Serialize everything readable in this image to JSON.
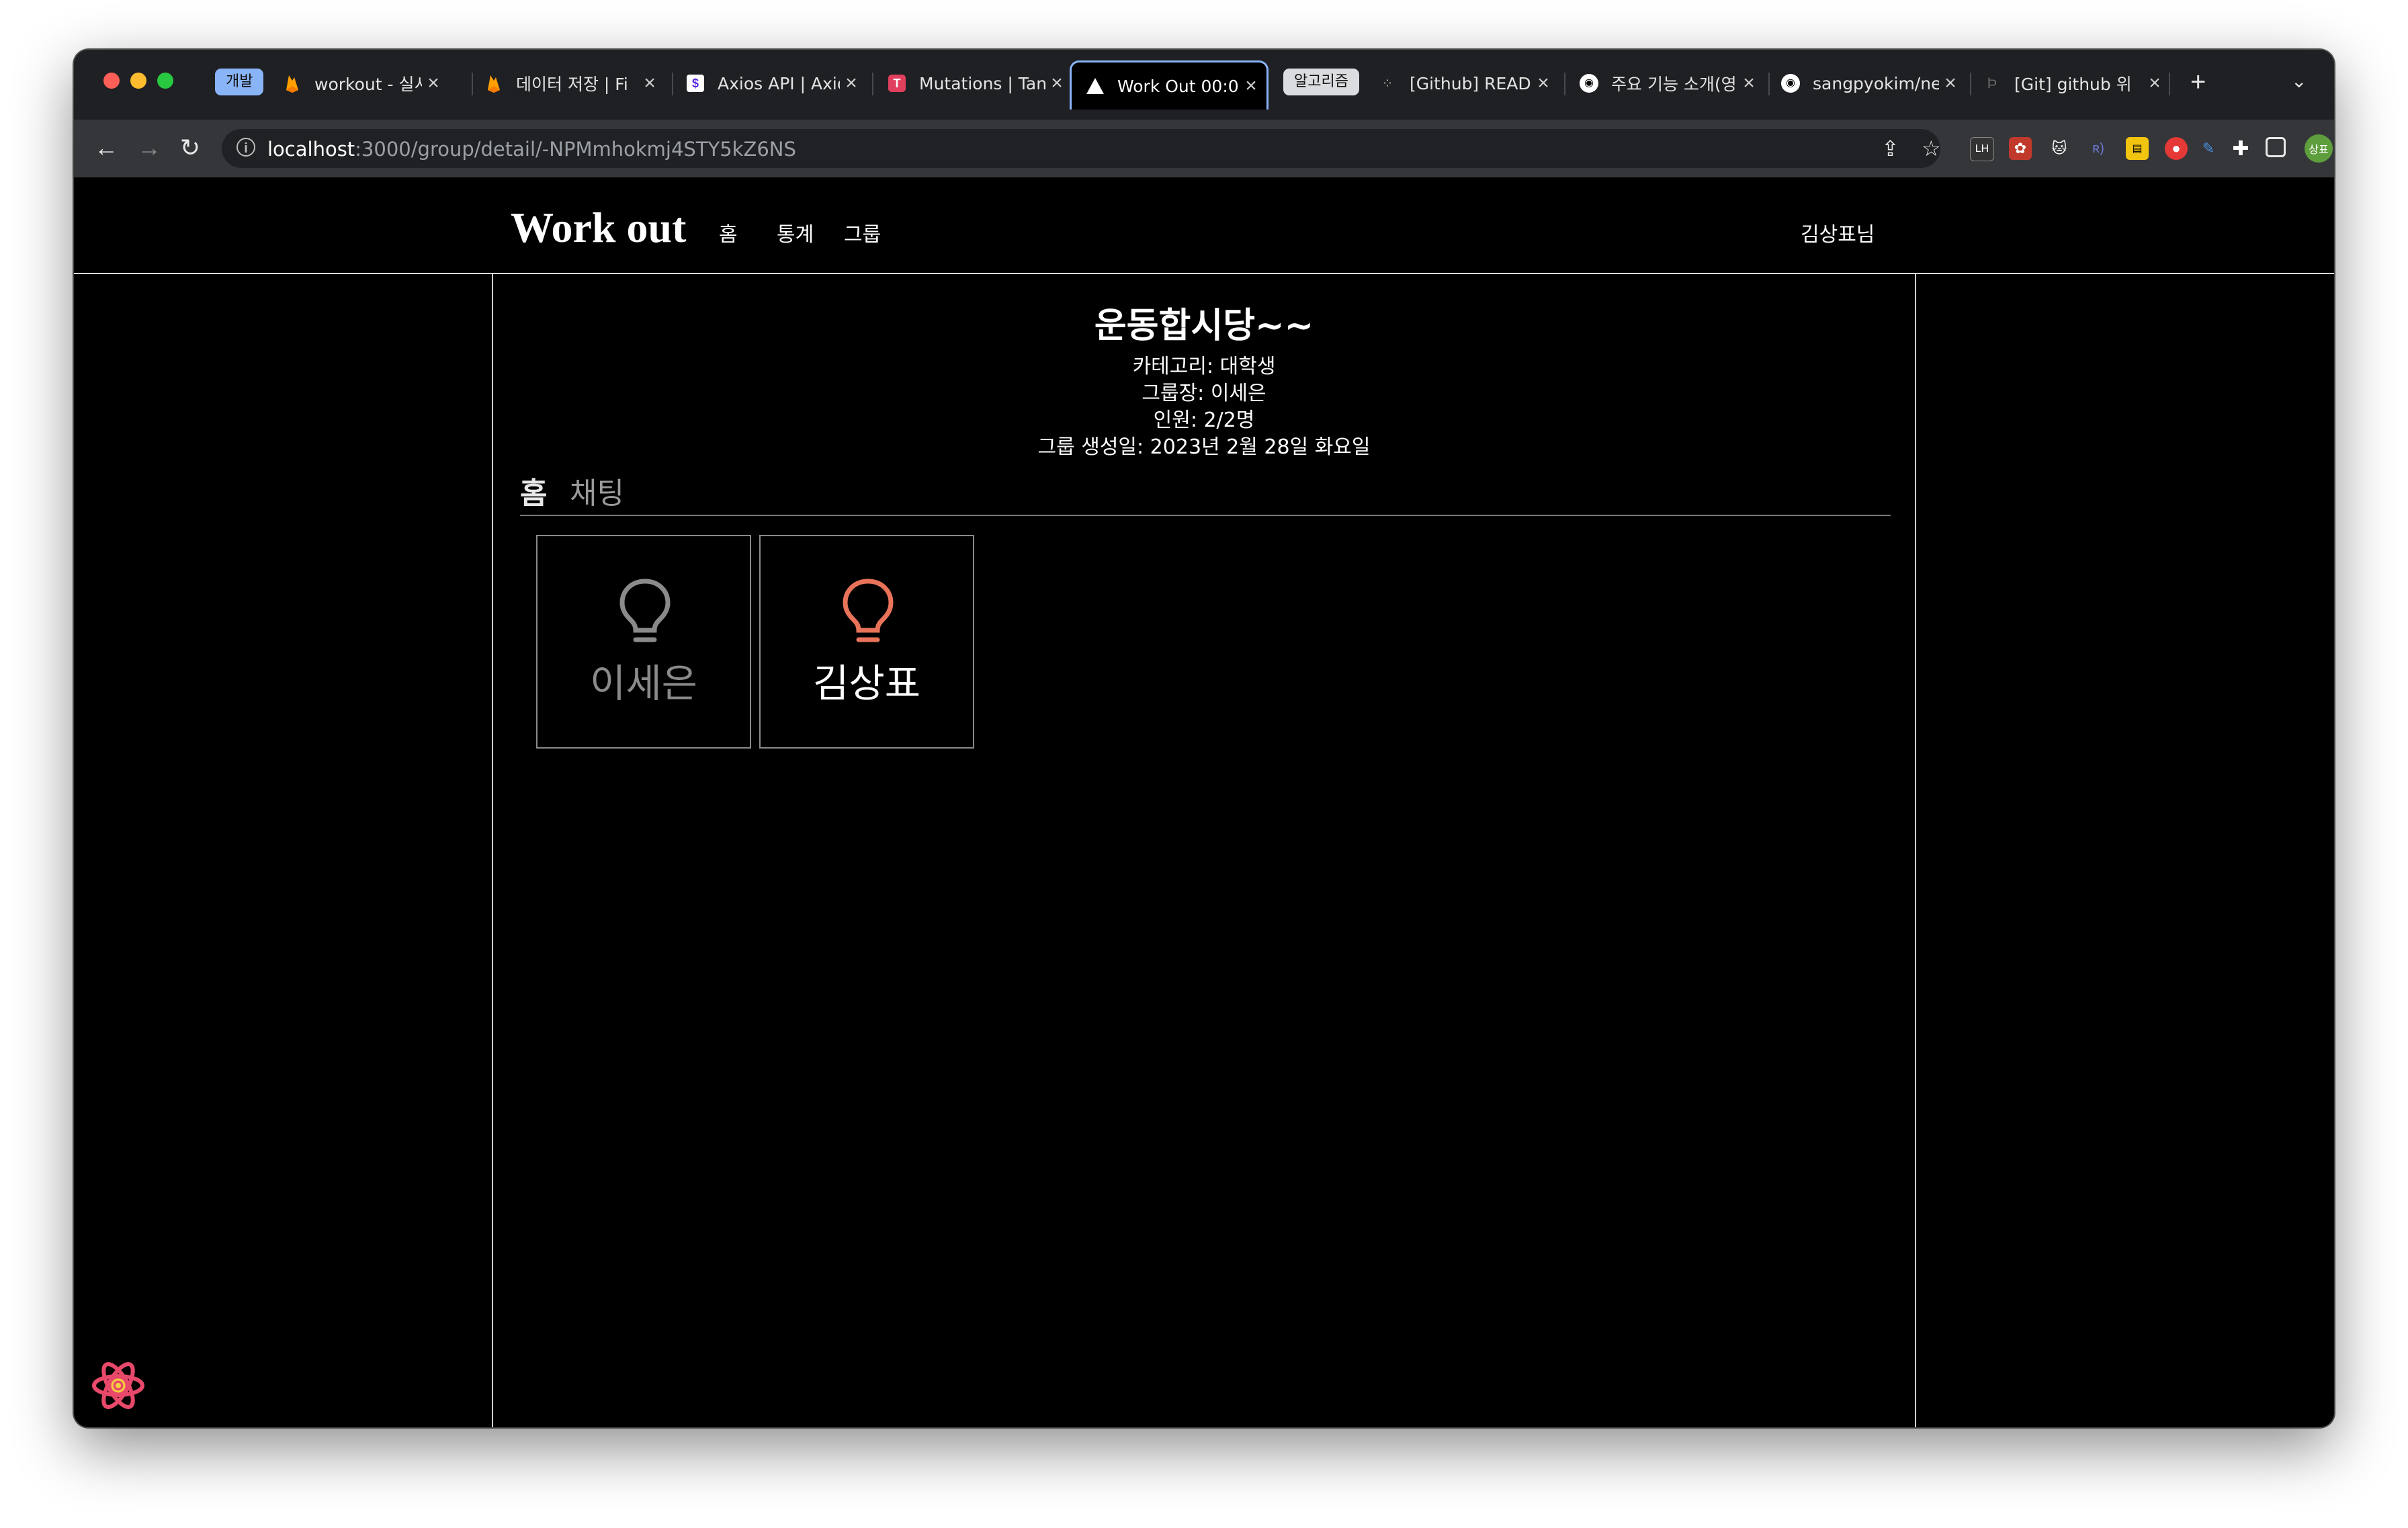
{
  "browser": {
    "tab_groups": [
      {
        "label": "개발",
        "color": "#8ab4f8"
      },
      {
        "label": "알고리즘",
        "color": "#dadce0"
      }
    ],
    "tabs": [
      {
        "title": "workout - 실시간",
        "icon": "firebase-icon"
      },
      {
        "title": "데이터 저장 | Fi",
        "icon": "firebase-icon"
      },
      {
        "title": "Axios API | Axios",
        "icon": "axios-icon"
      },
      {
        "title": "Mutations | Tan",
        "icon": "tanstack-icon"
      },
      {
        "title": "Work Out 00:0",
        "icon": "vercel-triangle-icon",
        "active": true
      },
      {
        "title": "[Github] READ",
        "icon": "site-icon"
      },
      {
        "title": "주요 기능 소개(영",
        "icon": "github-icon"
      },
      {
        "title": "sangpyokim/ne",
        "icon": "github-icon"
      },
      {
        "title": "[Git] github 위",
        "icon": "site-icon"
      }
    ],
    "url_host": "localhost",
    "url_path": ":3000/group/detail/-NPMmhokmj4STY5kZ6NS",
    "profile_label": "상표"
  },
  "site": {
    "brand": "Work out",
    "nav": [
      "홈",
      "통계",
      "그룹"
    ],
    "user": "김상표님"
  },
  "group": {
    "title": "운동합시당~~",
    "category": "카테고리: 대학생",
    "leader": "그룹장: 이세은",
    "members_count": "인원: 2/2명",
    "created": "그룹 생성일: 2023년 2월 28일 화요일"
  },
  "page_tabs": {
    "home": "홈",
    "chat": "채팅"
  },
  "members": [
    {
      "name": "이세은",
      "status_color": "#8a8a8a",
      "active": false
    },
    {
      "name": "김상표",
      "status_color": "#e8735a",
      "active": true
    }
  ]
}
